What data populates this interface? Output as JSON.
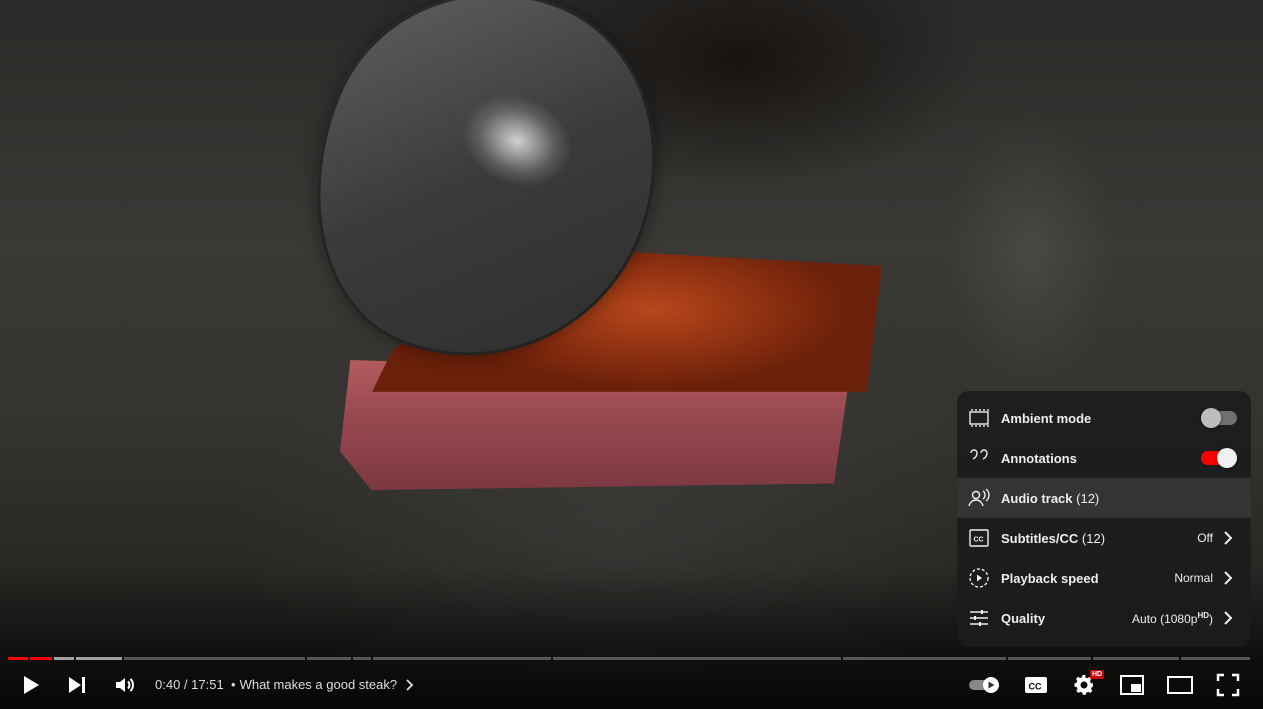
{
  "video": {
    "current_time": "0:40",
    "duration": "17:51",
    "chapter_title": "What makes a good steak?",
    "progress_fraction": 0.037
  },
  "settings_menu": {
    "items": [
      {
        "label": "Ambient mode",
        "icon": "ambient-mode-icon",
        "control": "toggle",
        "state": "off"
      },
      {
        "label": "Annotations",
        "icon": "annotations-icon",
        "control": "toggle",
        "state": "on"
      },
      {
        "label": "Audio track",
        "count": "(12)",
        "icon": "audio-track-icon",
        "value": ""
      },
      {
        "label": "Subtitles/CC",
        "count": "(12)",
        "icon": "subtitles-icon",
        "value": "Off"
      },
      {
        "label": "Playback speed",
        "icon": "playback-speed-icon",
        "value": "Normal"
      },
      {
        "label": "Quality",
        "icon": "quality-icon",
        "value": "Auto (1080p",
        "value_sup": "HD",
        "value_suffix": ")"
      }
    ]
  },
  "controls": {
    "play_icon": "play-icon",
    "next_icon": "next-icon",
    "volume_icon": "volume-icon",
    "autoplay_icon": "autoplay-toggle-icon",
    "subtitles_icon": "subtitles-icon",
    "settings_icon": "settings-icon",
    "settings_badge": "HD",
    "miniplayer_icon": "miniplayer-icon",
    "theater_icon": "theater-mode-icon",
    "fullscreen_icon": "fullscreen-icon",
    "separator": "•"
  },
  "colors": {
    "accent": "#ff0000",
    "menu_bg": "#1c1c1c",
    "text": "#eeeeee"
  }
}
